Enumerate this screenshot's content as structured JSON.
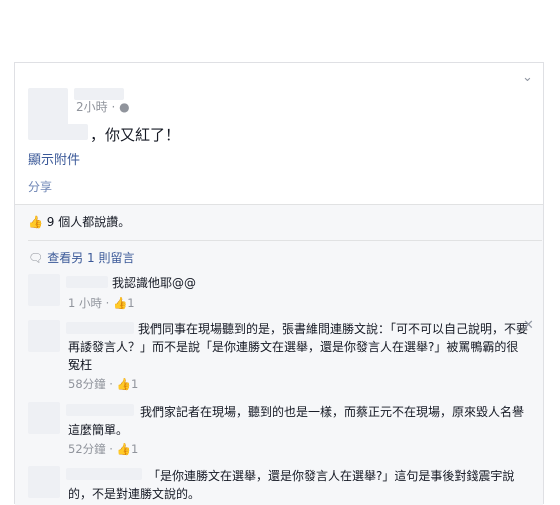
{
  "post": {
    "time": "2小時 ·",
    "privacy_icon": "globe-icon",
    "text": "，你又紅了！",
    "show_attachment": "顯示附件",
    "share": "分享"
  },
  "likes": {
    "icon": "thumbs-up-icon",
    "text": "9 個人都說讚。"
  },
  "view_more": {
    "icon": "comment-icon",
    "text": "查看另 1 則留言"
  },
  "comments": [
    {
      "text": "我認識他耶@@",
      "time": "1 小時 ·",
      "likes": "1"
    },
    {
      "text": "我們同事在現場聽到的是，張書維問連勝文說：「可不可以自己說明，不要再諉發言人？」而不是說「是你連勝文在選舉，還是你發言人在選舉?」被罵鴨霸的很冤枉",
      "time": "58分鐘 ·",
      "likes": "1"
    },
    {
      "text": "我們家記者在現場，聽到的也是一樣，而蔡正元不在現場，原來毀人名譽這麼簡單。",
      "time": "52分鐘 ·",
      "likes": "1"
    },
    {
      "text": "「是你連勝文在選舉，還是你發言人在選舉?」這句是事後對錢震宇說的，不是對連勝文說的。",
      "time": "",
      "likes": ""
    }
  ]
}
